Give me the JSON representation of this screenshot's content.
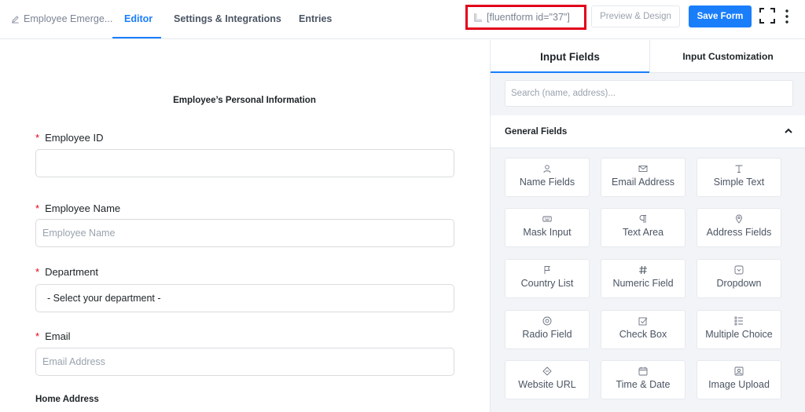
{
  "topbar": {
    "form_title": "Employee Emerge...",
    "tabs": [
      {
        "label": "Editor",
        "active": true
      },
      {
        "label": "Settings & Integrations",
        "active": false
      },
      {
        "label": "Entries",
        "active": false
      }
    ],
    "shortcode": "[fluentform id=\"37\"]",
    "preview_label": "Preview & Design",
    "save_label": "Save Form",
    "accent_color": "#1a7efb",
    "highlight_color": "#e2001a"
  },
  "editor": {
    "section_title": "Employee’s Personal Information",
    "fields": [
      {
        "label": "Employee ID",
        "required": true,
        "placeholder": ""
      },
      {
        "label": "Employee Name",
        "required": true,
        "placeholder": "Employee Name"
      },
      {
        "label": "Department",
        "required": true,
        "value": "- Select your department -"
      },
      {
        "label": "Email",
        "required": true,
        "placeholder": "Email Address"
      }
    ],
    "home_address_label": "Home Address"
  },
  "panel": {
    "tabs": [
      "Input Fields",
      "Input Customization"
    ],
    "search_placeholder": "Search (name, address)...",
    "group_title": "General Fields",
    "items": [
      {
        "label": "Name Fields",
        "icon": "user-icon"
      },
      {
        "label": "Email Address",
        "icon": "envelope-icon"
      },
      {
        "label": "Simple Text",
        "icon": "text-icon"
      },
      {
        "label": "Mask Input",
        "icon": "keyboard-icon"
      },
      {
        "label": "Text Area",
        "icon": "paragraph-icon"
      },
      {
        "label": "Address Fields",
        "icon": "map-pin-icon"
      },
      {
        "label": "Country List",
        "icon": "flag-icon"
      },
      {
        "label": "Numeric Field",
        "icon": "hash-icon"
      },
      {
        "label": "Dropdown",
        "icon": "dropdown-icon"
      },
      {
        "label": "Radio Field",
        "icon": "radio-icon"
      },
      {
        "label": "Check Box",
        "icon": "checkbox-icon"
      },
      {
        "label": "Multiple Choice",
        "icon": "list-icon"
      },
      {
        "label": "Website URL",
        "icon": "link-icon"
      },
      {
        "label": "Time & Date",
        "icon": "calendar-icon"
      },
      {
        "label": "Image Upload",
        "icon": "image-icon"
      }
    ]
  }
}
